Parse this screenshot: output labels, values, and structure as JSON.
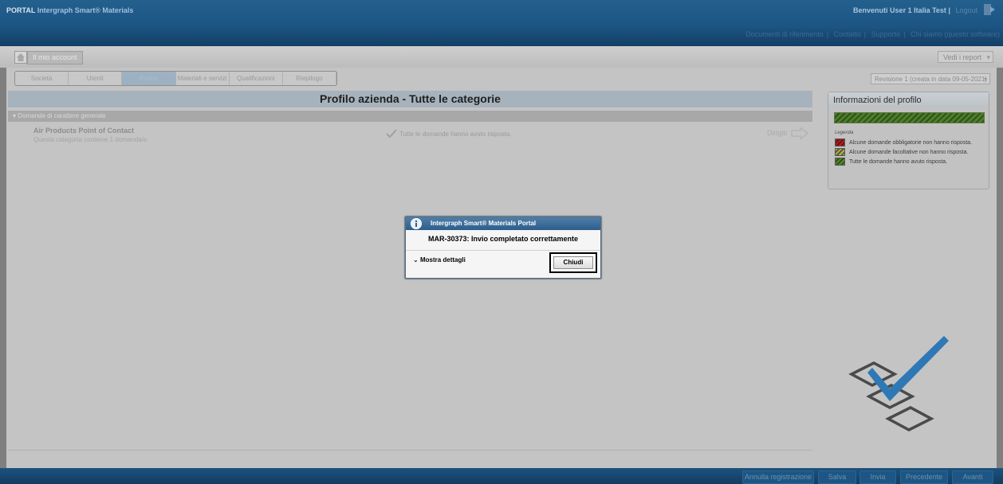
{
  "header": {
    "portal_label": "PORTAL",
    "product_name": "Intergraph Smart® Materials",
    "welcome": "Benvenuti User 1 Italia Test |",
    "logout": "Logout",
    "links": [
      "Documenti di riferimento",
      "Contatto",
      "Supporto",
      "Chi siamo (questo software)"
    ]
  },
  "toolbar": {
    "account_label": "Il mio account",
    "report_label": "Vedi i report"
  },
  "steps": [
    {
      "label": "Società",
      "active": false
    },
    {
      "label": "Utenti",
      "active": false
    },
    {
      "label": "Profilo",
      "active": true
    },
    {
      "label": "Materiali e servizi",
      "active": false
    },
    {
      "label": "Qualificazioni",
      "active": false
    },
    {
      "label": "Riepilogo",
      "active": false
    }
  ],
  "revision": "Revisione 1 (creata in data 09-05-2021)",
  "main": {
    "title": "Profilo azienda - Tutte le categorie",
    "category_header": "Domande di carattere generale",
    "category_name": "Air Products Point of Contact",
    "category_sub": "Questa categoria contiene 1 domanda/e.",
    "category_status": "Tutte le domande hanno avuto risposta.",
    "goto_label": "Dirigiti"
  },
  "info_panel": {
    "title": "Informazioni del profilo",
    "progress": 1.0,
    "legend_title": "Legenda",
    "legend": [
      {
        "color": "#b22020",
        "text": "Alcune domande obbligatorie non hanno risposta."
      },
      {
        "color": "#b9b62a",
        "text": "Alcune domande facoltative non hanno risposta."
      },
      {
        "color": "#5a8a2c",
        "text": "Tutte le domande hanno avuto risposta."
      }
    ]
  },
  "footer_buttons": [
    "Annulla registrazione",
    "Salva",
    "Invia",
    "Precedente",
    "Avanti"
  ],
  "modal": {
    "title": "Intergraph Smart® Materials Portal",
    "message": "MAR-30373: Invio completato correttamente",
    "details_label": "Mostra dettagli",
    "close_label": "Chiudi"
  }
}
